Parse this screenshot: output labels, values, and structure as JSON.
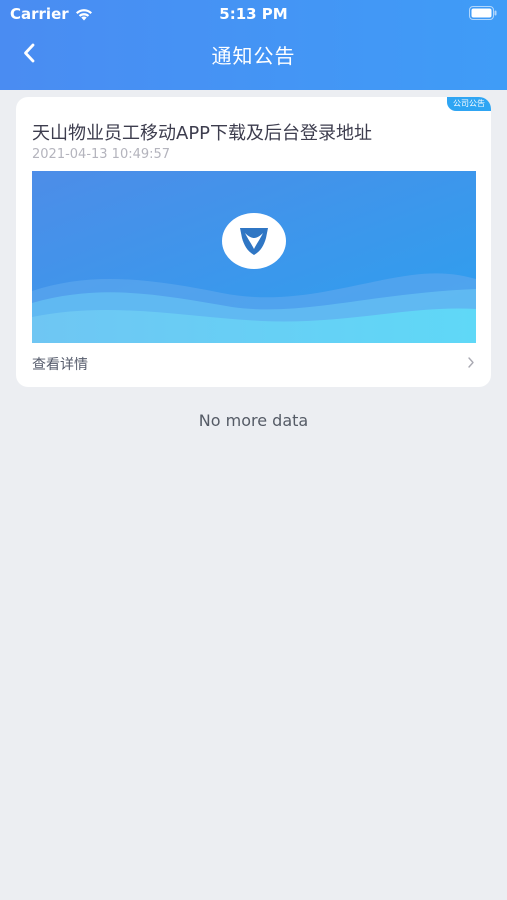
{
  "status_bar": {
    "carrier": "Carrier",
    "time": "5:13 PM"
  },
  "nav": {
    "title": "通知公告",
    "back_icon": "chevron-left-icon"
  },
  "notices": [
    {
      "tag": "公司公告",
      "title": "天山物业员工移动APP下载及后台登录地址",
      "date": "2021-04-13 10:49:57",
      "detail_label": "查看详情"
    }
  ],
  "footer": {
    "no_more": "No more data"
  },
  "colors": {
    "header_start": "#4a8cf2",
    "header_end": "#3f9cf7",
    "tag": "#2fa5f3",
    "background": "#eceef2"
  }
}
